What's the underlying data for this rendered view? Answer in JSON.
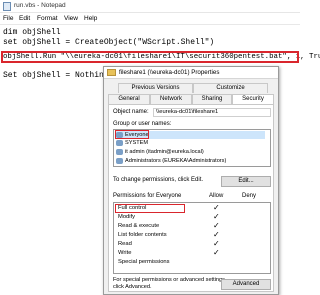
{
  "notepad": {
    "title": "run.vbs - Notepad",
    "menu": [
      "File",
      "Edit",
      "Format",
      "View",
      "Help"
    ],
    "lines": [
      "dim objShell",
      "set objShell = CreateObject(\"WScript.Shell\")",
      "",
      "objShell.Run \"\\\\eureka-dc01\\fileshare1\\IT\\securit360pentest.bat\", 1, True",
      "",
      "Set objShell = Nothing"
    ]
  },
  "dialog": {
    "title": "fileshare1 (\\\\eureka-dc01) Properties",
    "tabs_top": [
      "Previous Versions",
      "Customize"
    ],
    "tabs_bottom": [
      "General",
      "Network",
      "Sharing",
      "Security"
    ],
    "object_name_label": "Object name:",
    "object_name_value": "\\\\eureka-dc01\\fileshare1",
    "group_label": "Group or user names:",
    "groups": [
      "Everyone",
      "SYSTEM",
      "it admin (itadmin@eureka.local)",
      "Administrators (EUREKA\\Administrators)"
    ],
    "change_perm_text": "To change permissions, click Edit.",
    "edit_button": "Edit...",
    "permissions_label": "Permissions for Everyone",
    "allow_label": "Allow",
    "deny_label": "Deny",
    "permissions": [
      {
        "name": "Full control",
        "allow": "✓"
      },
      {
        "name": "Modify",
        "allow": "✓"
      },
      {
        "name": "Read & execute",
        "allow": "✓"
      },
      {
        "name": "List folder contents",
        "allow": "✓"
      },
      {
        "name": "Read",
        "allow": "✓"
      },
      {
        "name": "Write",
        "allow": "✓"
      },
      {
        "name": "Special permissions",
        "allow": ""
      }
    ],
    "special_text_1": "For special permissions or advanced settings,",
    "special_text_2": "click Advanced.",
    "advanced_button": "Advanced"
  },
  "colors": {
    "highlight_border": "#d9262d",
    "selection": "#cde5fb"
  }
}
